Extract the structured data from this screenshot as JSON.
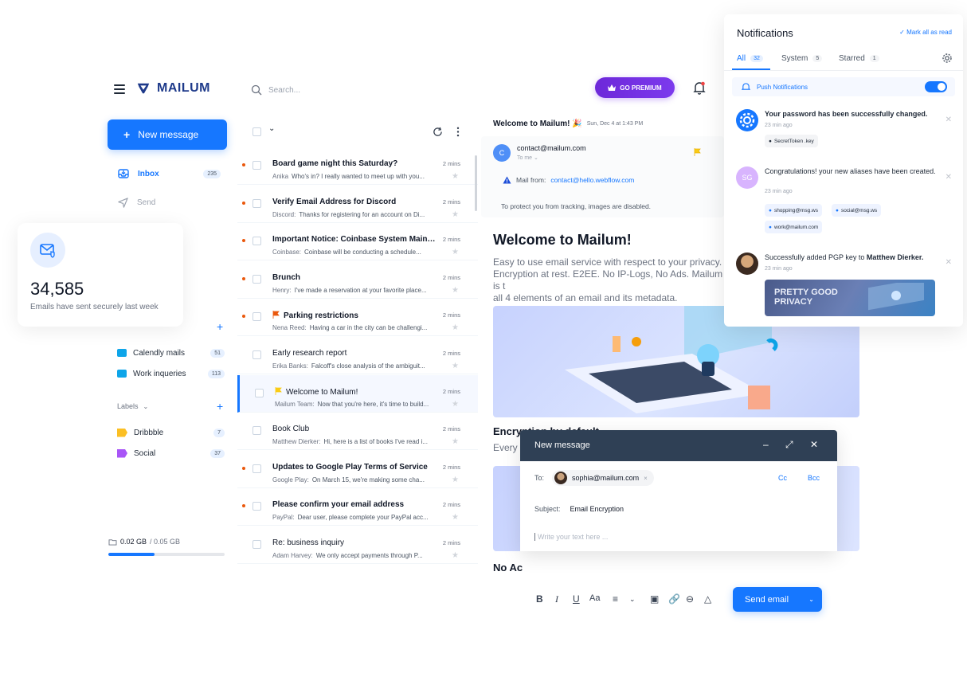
{
  "brand": {
    "name": "MAILUM"
  },
  "sidebar": {
    "new_message": "New message",
    "inbox": {
      "label": "Inbox",
      "count": "235"
    },
    "send": {
      "label": "Send"
    },
    "folders": [
      {
        "label": "Calendly mails",
        "count": "51",
        "color": "#0ea5e9"
      },
      {
        "label": "Work inqueries",
        "count": "113",
        "color": "#0ea5e9"
      }
    ],
    "labels_title": "Labels",
    "labels": [
      {
        "label": "Dribbble",
        "count": "7",
        "color": "#fbbf24"
      },
      {
        "label": "Social",
        "count": "37",
        "color": "#a855f7"
      }
    ],
    "storage": {
      "used": "0.02 GB",
      "total": "/ 0.05 GB",
      "fraction": 0.4
    }
  },
  "stat_card": {
    "value": "34,585",
    "label": "Emails have sent securely last week"
  },
  "search": {
    "placeholder": "Search..."
  },
  "mails": [
    {
      "subject": "Board game night this Saturday?",
      "sender": "Anika",
      "preview": "Who's in? I really wanted to meet up with you...",
      "time": "2 mins",
      "unread": true,
      "flag": null
    },
    {
      "subject": "Verify Email Address for Discord",
      "sender": "Discord:",
      "preview": "Thanks for registering for an account on Di...",
      "time": "2 mins",
      "unread": true,
      "flag": null
    },
    {
      "subject": "Important Notice: Coinbase System Mainte...",
      "sender": "Coinbase:",
      "preview": "Coinbase will be conducting a schedule...",
      "time": "2 mins",
      "unread": true,
      "flag": null
    },
    {
      "subject": "Brunch",
      "sender": "Henry:",
      "preview": "I've made a reservation at your favorite place...",
      "time": "2 mins",
      "unread": true,
      "flag": null
    },
    {
      "subject": "Parking restrictions",
      "sender": "Nena Reed:",
      "preview": "Having a car in the city can be challengi...",
      "time": "2 mins",
      "unread": true,
      "flag": "#ea580c"
    },
    {
      "subject": "Early research report",
      "sender": "Erika Banks:",
      "preview": "Falcoff's close analysis of the ambiguit...",
      "time": "2 mins",
      "unread": false,
      "flag": null
    },
    {
      "subject": "Welcome to Mailum!",
      "sender": "Mailum Team:",
      "preview": "Now that you're here, it's time to build...",
      "time": "2 mins",
      "unread": false,
      "flag": "#facc15",
      "selected": true
    },
    {
      "subject": "Book Club",
      "sender": "Matthew Dierker:",
      "preview": "Hi, here is a list of books I've read i...",
      "time": "2 mins",
      "unread": false,
      "flag": null
    },
    {
      "subject": "Updates to Google Play Terms of Service",
      "sender": "Google Play:",
      "preview": "On March 15, we're making some cha...",
      "time": "2 mins",
      "unread": true,
      "flag": null
    },
    {
      "subject": "Please confirm your email address",
      "sender": "PayPal:",
      "preview": "Dear user, please complete your PayPal acc...",
      "time": "2 mins",
      "unread": true,
      "flag": null
    },
    {
      "subject": "Re: business inquiry",
      "sender": "Adam Harvey:",
      "preview": "We only accept payments through P...",
      "time": "2 mins",
      "unread": false,
      "flag": null
    }
  ],
  "topbar": {
    "premium": "GO PREMIUM"
  },
  "reader": {
    "header_title": "Welcome to Mailum! 🎉",
    "header_date": "Sun, Dec 4 at 1:43 PM",
    "avatar_letter": "C",
    "from_email": "contact@mailum.com",
    "to_me": "To me",
    "mail_from_label": "Mail from:",
    "mail_from_value": "contact@hello.webflow.com",
    "protect_note": "To protect you from tracking, images are disabled.",
    "title": "Welcome to Mailum!",
    "body": "Easy to use email service with respect to your privacy.\nEncryption at rest. E2EE. No IP-Logs, No Ads. Mailum is t\nall 4 elements of an email and its metadata.",
    "section_title": "Encryption by default",
    "section_body": "Every e",
    "section2_title": "No Ac"
  },
  "compose": {
    "title": "New message",
    "to_label": "To:",
    "to_email": "sophia@mailum.com",
    "cc": "Cc",
    "bcc": "Bcc",
    "subject_label": "Subject:",
    "subject_value": "Email Encryption",
    "placeholder": "Write your text here ...",
    "send": "Send email"
  },
  "notifications": {
    "title": "Notifications",
    "mark_all": "Mark all as read",
    "tabs": [
      {
        "label": "All",
        "count": "32"
      },
      {
        "label": "System",
        "count": "5"
      },
      {
        "label": "Starred",
        "count": "1"
      }
    ],
    "push": "Push Notifications",
    "items": [
      {
        "text": "Your password has been successfully changed.",
        "time": "23 min ago",
        "chips": [
          "SecretToken .key"
        ]
      },
      {
        "text": "Congratulations! your new aliases have been created.",
        "time": "23 min ago",
        "chips": [
          "shopping@msg.ws",
          "social@msg.ws",
          "work@mailum.com"
        ],
        "avatar": "SG"
      },
      {
        "text_prefix": "Successfully added PGP key to ",
        "text_name": "Matthew Dierker.",
        "time": "23 min ago"
      }
    ],
    "pgp_banner": "PRETTY GOOD\nPRIVACY"
  }
}
